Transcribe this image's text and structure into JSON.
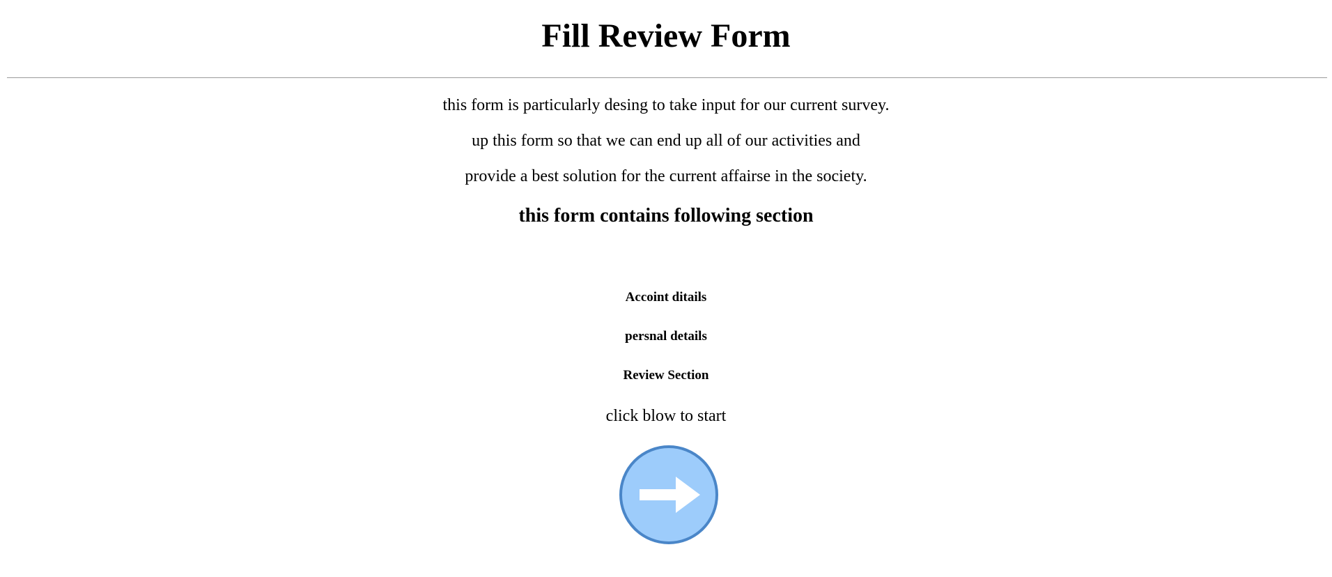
{
  "header": {
    "title": "Fill Review Form"
  },
  "intro": {
    "lines": [
      "this form is particularly desing to take input for our current survey.",
      "up this form so that we can end up all of our activities and",
      "provide a best solution for the current affairse in the society."
    ]
  },
  "sections": {
    "heading": "this form contains following section",
    "items": [
      "Accoint ditails",
      "persnal details",
      "Review Section"
    ]
  },
  "start": {
    "prompt": "click blow to start",
    "button_icon": "arrow-right-icon",
    "colors": {
      "fill": "#9dccfb",
      "border": "#4a86c8",
      "arrow": "#ffffff"
    }
  }
}
